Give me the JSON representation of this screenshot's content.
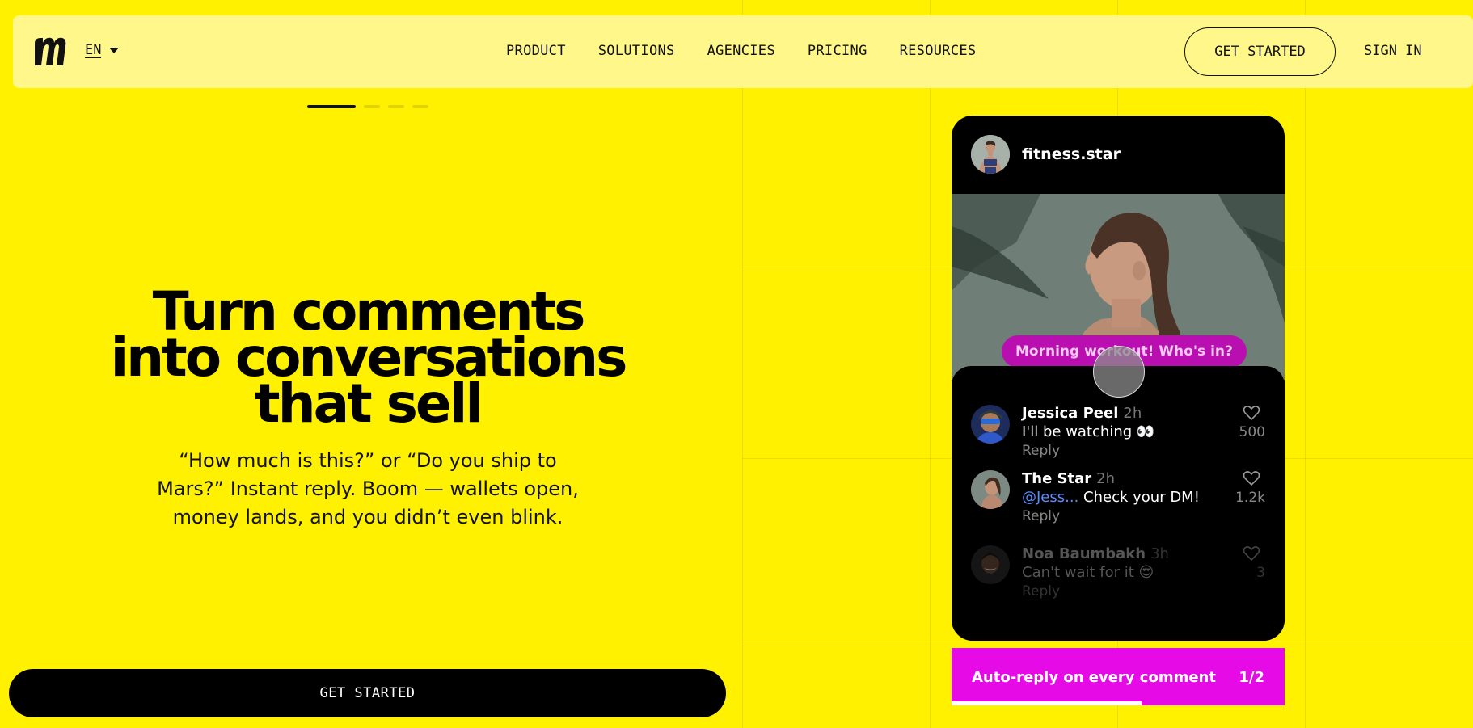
{
  "nav": {
    "logo_alt": "m",
    "lang": "EN",
    "links": [
      "PRODUCT",
      "SOLUTIONS",
      "AGENCIES",
      "PRICING",
      "RESOURCES"
    ],
    "get_started": "GET STARTED",
    "sign_in": "SIGN IN"
  },
  "slides": {
    "total": 4,
    "active": 1
  },
  "hero": {
    "title_line1": "Turn comments",
    "title_line2": "into conversations",
    "title_line3": "that sell",
    "subtitle_line1": "“How much is this?” or “Do you ship to",
    "subtitle_line2": "Mars?” Instant reply. Boom — wallets open,",
    "subtitle_line3": "money lands, and you didn’t even blink.",
    "cta": "GET STARTED"
  },
  "phone": {
    "username": "fitness.star",
    "caption": "Morning workout! Who's in?",
    "comments": [
      {
        "name": "Jessica Peel",
        "time": "2h",
        "text": "I'll be watching 👀",
        "reply": "Reply",
        "likes": "500"
      },
      {
        "name": "The Star",
        "time": "2h",
        "mention": "@Jess...",
        "text": " Check your DM!",
        "reply": "Reply",
        "likes": "1.2k"
      },
      {
        "name": "Noa Baumbakh",
        "time": "3h",
        "text": "Can't wait for it 😍",
        "reply": "Reply",
        "likes": "3"
      }
    ]
  },
  "feature_bar": {
    "label": "Auto-reply on every comment",
    "counter": "1/2",
    "progress": 0.57
  },
  "colors": {
    "background": "#FFF100",
    "nav_bg": "#FFF78A",
    "accent_magenta": "#E60AE6",
    "mention_blue": "#5B8CFF"
  }
}
